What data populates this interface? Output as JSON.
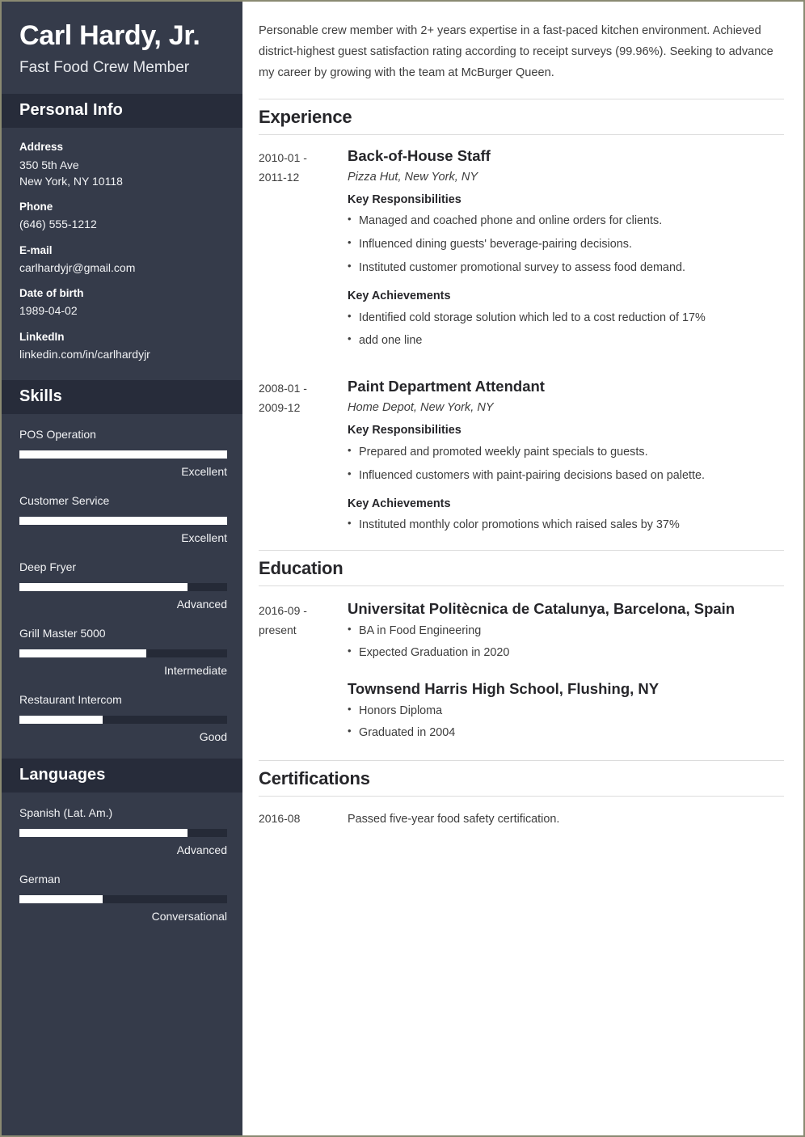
{
  "sidebar": {
    "full_name": "Carl Hardy, Jr.",
    "job_title": "Fast Food Crew Member",
    "personal_info": {
      "heading": "Personal Info",
      "items": [
        {
          "label": "Address",
          "value": "350 5th Ave",
          "value2": "New York, NY 10118"
        },
        {
          "label": "Phone",
          "value": "(646) 555-1212"
        },
        {
          "label": "E-mail",
          "value": "carlhardyjr@gmail.com"
        },
        {
          "label": "Date of birth",
          "value": "1989-04-02"
        },
        {
          "label": "LinkedIn",
          "value": "linkedin.com/in/carlhardyjr"
        }
      ]
    },
    "skills": {
      "heading": "Skills",
      "items": [
        {
          "name": "POS Operation",
          "level": "Excellent",
          "percent": 100
        },
        {
          "name": "Customer Service",
          "level": "Excellent",
          "percent": 100
        },
        {
          "name": "Deep Fryer",
          "level": "Advanced",
          "percent": 81
        },
        {
          "name": "Grill Master 5000",
          "level": "Intermediate",
          "percent": 61
        },
        {
          "name": "Restaurant Intercom",
          "level": "Good",
          "percent": 40
        }
      ]
    },
    "languages": {
      "heading": "Languages",
      "items": [
        {
          "name": "Spanish (Lat. Am.)",
          "level": "Advanced",
          "percent": 81
        },
        {
          "name": "German",
          "level": "Conversational",
          "percent": 40
        }
      ]
    }
  },
  "main": {
    "summary": "Personable crew member with 2+ years expertise in a fast-paced kitchen environment. Achieved district-highest guest satisfaction rating according to receipt surveys (99.96%). Seeking to advance my career by growing with the team at McBurger Queen.",
    "experience": {
      "heading": "Experience",
      "entries": [
        {
          "date_from": "2010-01 -",
          "date_to": "2011-12",
          "title": "Back-of-House Staff",
          "org": "Pizza Hut, New York, NY",
          "responsibilities_heading": "Key Responsibilities",
          "responsibilities": [
            "Managed and coached phone and online orders for clients.",
            "Influenced dining guests' beverage-pairing decisions.",
            "Instituted customer promotional survey to assess food demand."
          ],
          "achievements_heading": "Key Achievements",
          "achievements": [
            "Identified cold storage solution which led to a cost reduction of 17%",
            "add one line"
          ]
        },
        {
          "date_from": "2008-01 -",
          "date_to": "2009-12",
          "title": "Paint Department Attendant",
          "org": "Home Depot, New York, NY",
          "responsibilities_heading": "Key Responsibilities",
          "responsibilities": [
            "Prepared and promoted weekly paint specials to guests.",
            "Influenced customers with paint-pairing decisions based on palette."
          ],
          "achievements_heading": "Key Achievements",
          "achievements": [
            "Instituted monthly color promotions which raised sales by 37%"
          ]
        }
      ]
    },
    "education": {
      "heading": "Education",
      "date_from": "2016-09 -",
      "date_to": "present",
      "schools": [
        {
          "title": "Universitat Politècnica de Catalunya, Barcelona, Spain",
          "points": [
            "BA in Food Engineering",
            "Expected Graduation in 2020"
          ]
        },
        {
          "title": "Townsend Harris High School, Flushing, NY",
          "points": [
            "Honors Diploma",
            "Graduated in 2004"
          ]
        }
      ]
    },
    "certifications": {
      "heading": "Certifications",
      "entries": [
        {
          "date": "2016-08",
          "text": "Passed five-year food safety certification."
        }
      ]
    }
  },
  "colors": {
    "sidebar_bg": "#353b4a",
    "sidebar_band": "#272c3a",
    "bar_track": "#252a37",
    "bar_fill": "#ffffff",
    "page_border": "#8a8a72",
    "text_dark": "#26262a",
    "text_body": "#3d3d3d"
  }
}
